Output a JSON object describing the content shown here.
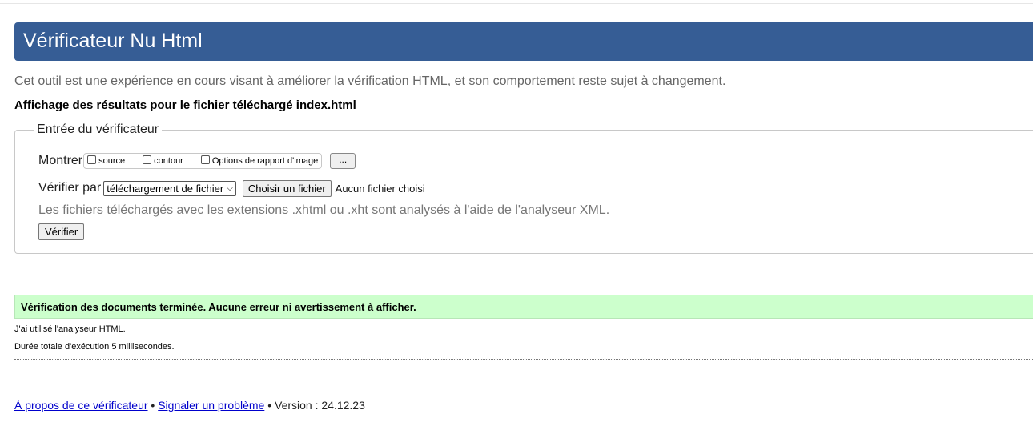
{
  "header": {
    "title": "Vérificateur Nu Html"
  },
  "intro_text": "Cet outil est une expérience en cours visant à améliorer la vérification HTML, et son comportement reste sujet à changement.",
  "results_for": "Affichage des résultats pour le fichier téléchargé index.html",
  "form": {
    "legend": "Entrée du vérificateur",
    "show_label": "Montrer",
    "show_options": [
      {
        "label": "source",
        "checked": false
      },
      {
        "label": "contour",
        "checked": false
      },
      {
        "label": "Options de rapport d'image",
        "checked": false
      }
    ],
    "more_button": "...",
    "check_by_label": "Vérifier par",
    "check_by_value": "téléchargement de fichier",
    "choose_file_button": "Choisir un fichier",
    "no_file_text": "Aucun fichier choisi",
    "hint": "Les fichiers téléchargés avec les extensions .xhtml ou .xht sont analysés à l'aide de l'analyseur XML.",
    "submit_button": "Vérifier"
  },
  "result": {
    "success_message": "Vérification des documents terminée. Aucune erreur ni avertissement à afficher.",
    "parser_note": "J'ai utilisé l'analyseur HTML.",
    "duration_note": "Durée totale d'exécution 5 millisecondes."
  },
  "footer": {
    "about_link": "À propos de ce vérificateur",
    "separator": "•",
    "report_link": "Signaler un problème",
    "version": "Version : 24.12.23"
  },
  "colors": {
    "header_bg": "#365d95",
    "success_bg": "#ccffcc"
  }
}
